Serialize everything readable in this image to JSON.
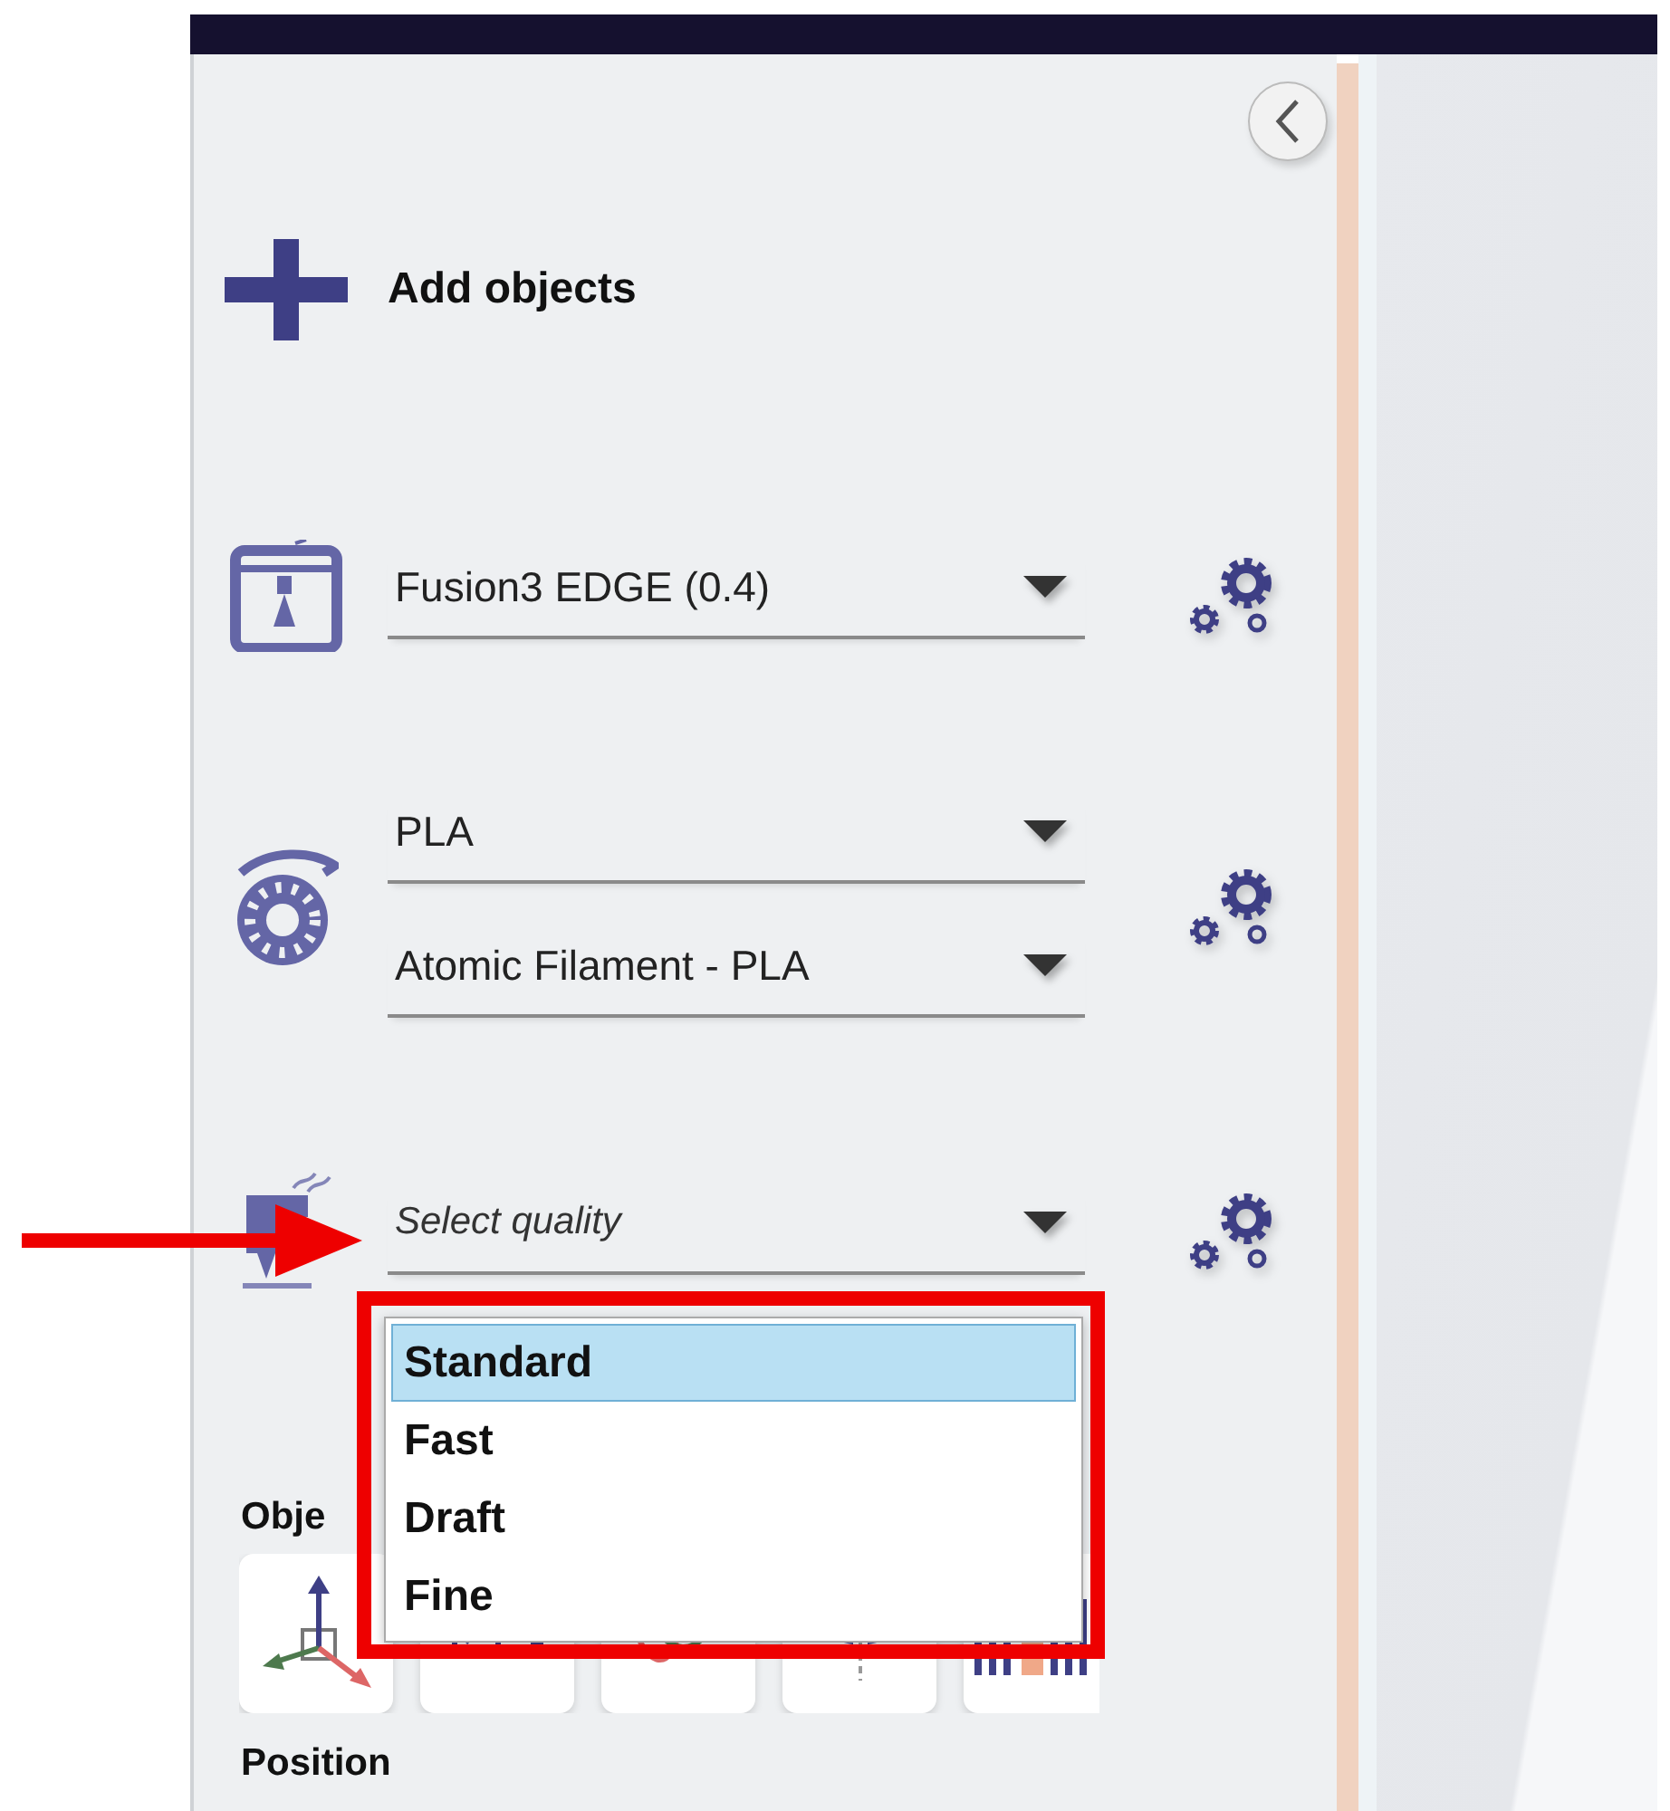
{
  "add_objects": {
    "label": "Add objects"
  },
  "printer": {
    "value": "Fusion3 EDGE (0.4)"
  },
  "material": {
    "fields": [
      {
        "value": "PLA"
      },
      {
        "value": "Atomic Filament - PLA"
      }
    ]
  },
  "quality": {
    "placeholder": "Select quality",
    "options": [
      {
        "label": "Standard",
        "selected": true
      },
      {
        "label": "Fast",
        "selected": false
      },
      {
        "label": "Draft",
        "selected": false
      },
      {
        "label": "Fine",
        "selected": false
      }
    ]
  },
  "objects_heading": "Obje",
  "tools": [
    {
      "kind": "axes"
    },
    {
      "kind": "scale"
    },
    {
      "kind": "curves"
    },
    {
      "kind": "split"
    },
    {
      "kind": "bars"
    }
  ],
  "position_heading": "Position"
}
